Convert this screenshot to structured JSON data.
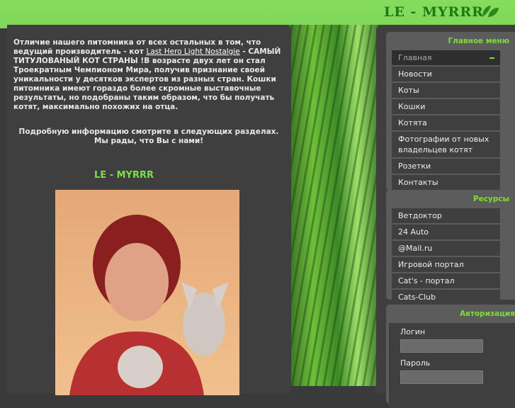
{
  "logo": "LE - MYRRR",
  "intro": {
    "p1": "Отличие нашего питомника от всех остальных в том, что ведущий производитель - кот ",
    "link": "Last Hero Light Nostalgie",
    "p2": " - САМЫЙ ТИТУЛОВАНЫЙ КОТ СТРАНЫ  !В возрасте двух лет он стал Троекратным Чемпионом Мира, получив признание своей уникальности у десятков экспертов из разных стран. Кошки питомника имеют гораздо более скромные выставочные результаты, но подобраны таким образом, что бы получать котят, максимально похожих на отца."
  },
  "more": "Подробную информацию смотрите в следующих разделах. Мы рады, что Вы с нами!",
  "heading": "LE - MYRRR",
  "menu": {
    "title": "Главное меню",
    "items": [
      "Главная",
      "Новости",
      "Коты",
      "Кошки",
      "Котята",
      "Фотографии от новых владельцев котят",
      "Розетки",
      "Контакты"
    ]
  },
  "resources": {
    "title": "Ресурсы",
    "items": [
      "Ветдоктор",
      "24 Auto",
      "@Mail.ru",
      "Игровой портал",
      "Cat's - портал",
      "Cats-Club"
    ]
  },
  "auth": {
    "title": "Авторизация",
    "login": "Логин",
    "password": "Пароль",
    "login_value": "",
    "password_value": ""
  },
  "colors": {
    "accent": "#7fdc3a",
    "header": "#86dd5c",
    "panel": "#3f3f3f"
  }
}
